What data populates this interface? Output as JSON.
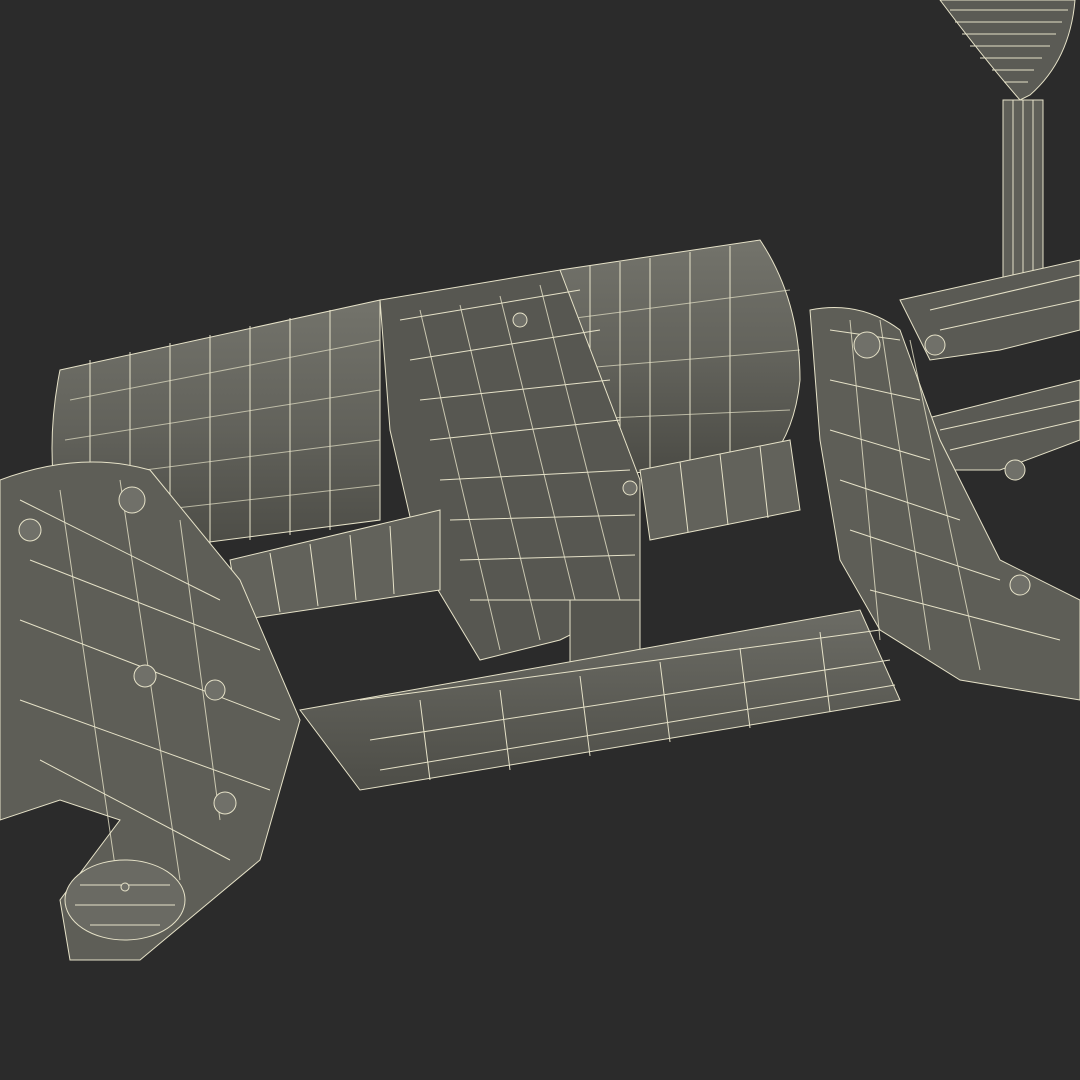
{
  "scene": {
    "subject": "wireframe-render",
    "colors": {
      "background": "#2b2b2b",
      "surface": "#5b5b55",
      "surface_light": "#6d6d66",
      "surface_dark": "#45453f",
      "wire": "#e6e2c8",
      "shadow": "#1f1f1f"
    }
  }
}
